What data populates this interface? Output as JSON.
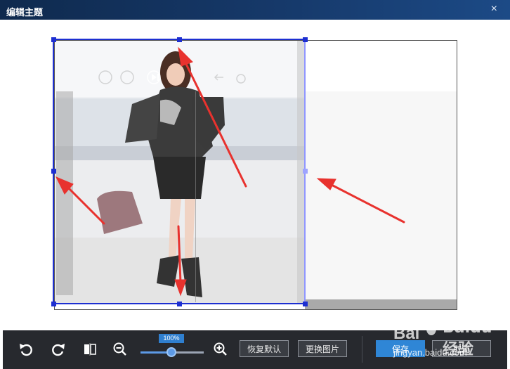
{
  "window": {
    "title": "编辑主题",
    "close_icon": "×"
  },
  "toolbar": {
    "zoom_level": "100%",
    "zoom_fraction": 0.5,
    "restore_default_label": "恢复默认",
    "replace_image_label": "更换图片",
    "save_label": "保存",
    "cancel_label": "取消"
  },
  "colors": {
    "titlebar": "#16396a",
    "toolbar": "#27292e",
    "accent": "#2f86d6",
    "selection": "#1d2fd1",
    "arrow": "#e8322e"
  },
  "watermark": {
    "brand": "Baidu 经验",
    "url": "jingyan.baidu.com"
  }
}
